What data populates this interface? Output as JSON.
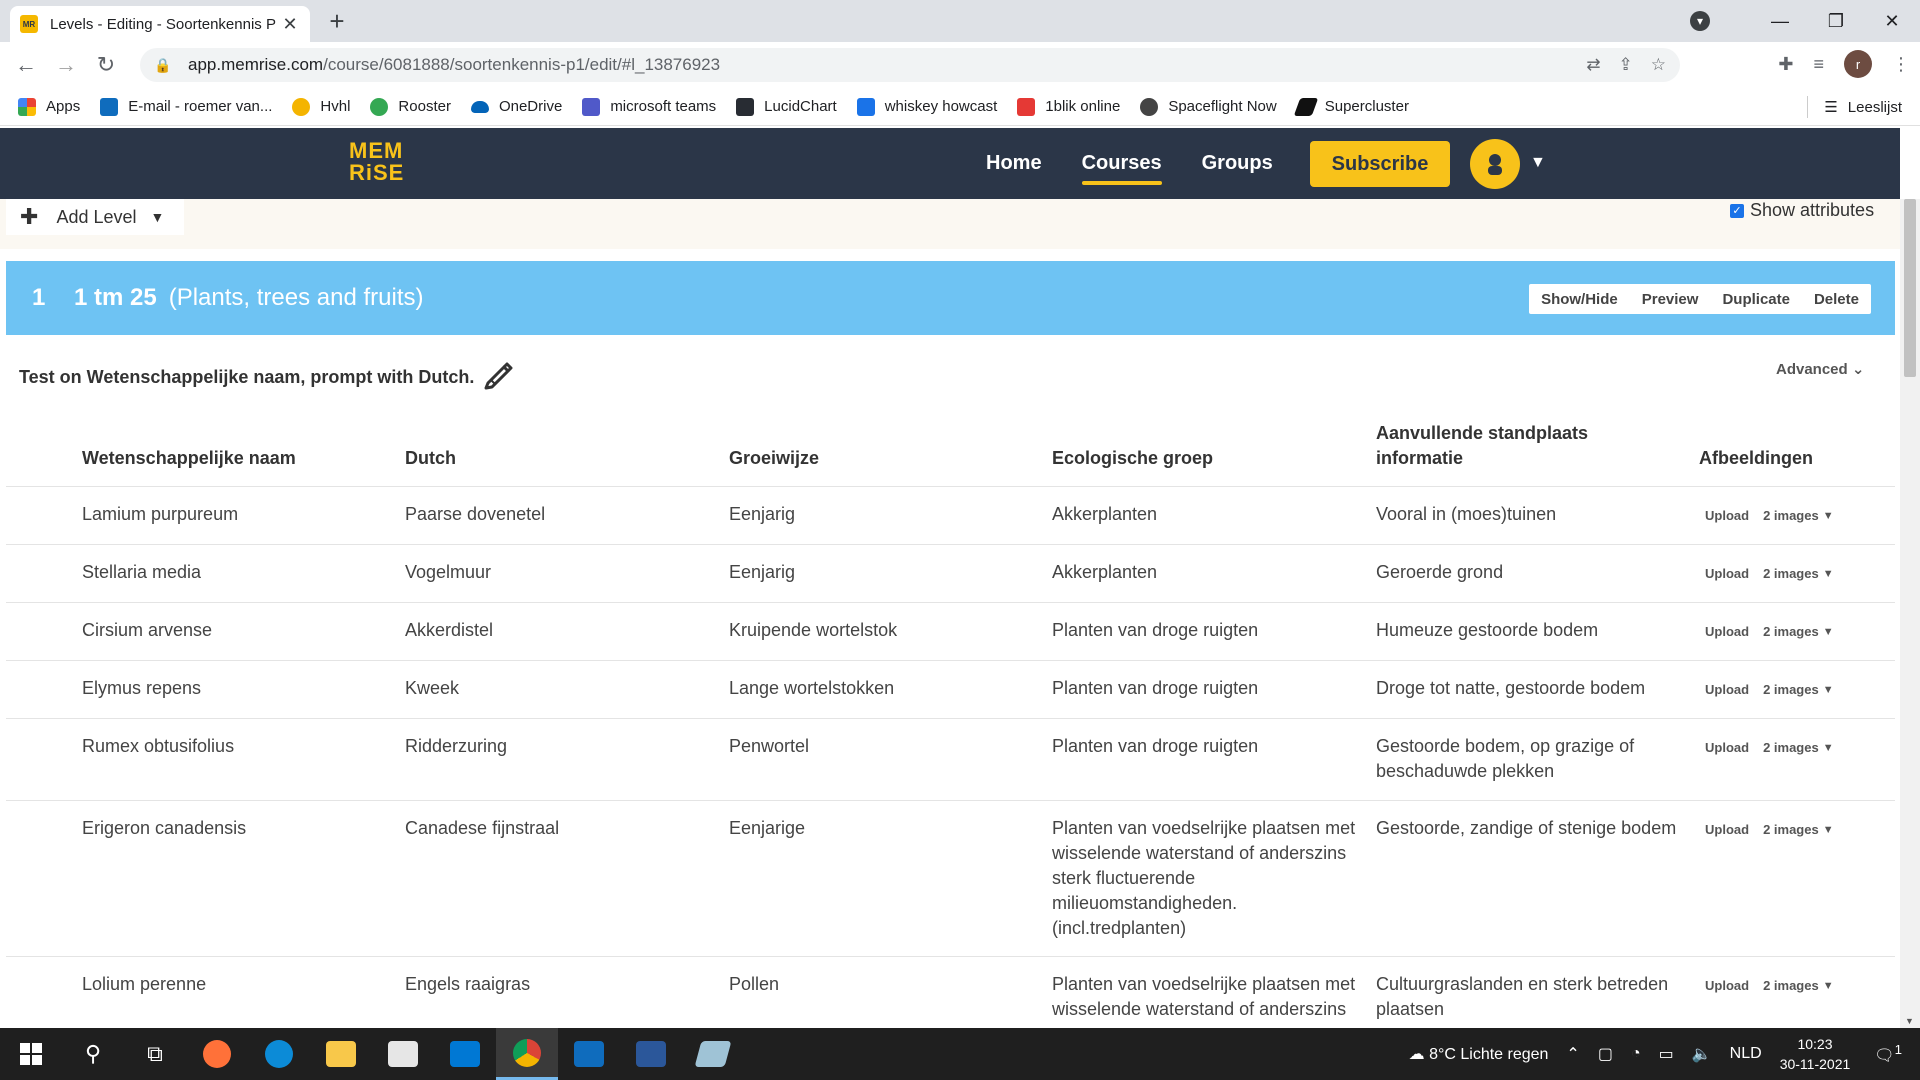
{
  "browser": {
    "tab_title": "Levels - Editing - Soortenkennis P",
    "url_domain": "app.memrise.com",
    "url_path": "/course/6081888/soortenkennis-p1/edit/#l_13876923",
    "profile_initial": "r",
    "bookmarks": [
      {
        "label": "Apps",
        "color": "#ea4335"
      },
      {
        "label": "E-mail - roemer van...",
        "color": "#0f6cbd"
      },
      {
        "label": "Hvhl",
        "color": "#f4b400"
      },
      {
        "label": "Rooster",
        "color": "#34a853"
      },
      {
        "label": "OneDrive",
        "color": "#0364b8"
      },
      {
        "label": "microsoft teams",
        "color": "#5059c9"
      },
      {
        "label": "LucidChart",
        "color": "#282c33"
      },
      {
        "label": "whiskey howcast",
        "color": "#1a73e8"
      },
      {
        "label": "1blik online",
        "color": "#e53935"
      },
      {
        "label": "Spaceflight Now",
        "color": "#444444"
      },
      {
        "label": "Supercluster",
        "color": "#111111"
      }
    ],
    "reading_list": "Leeslijst"
  },
  "header": {
    "logo_line1": "MEM",
    "logo_line2": "RiSE",
    "nav": [
      "Home",
      "Courses",
      "Groups"
    ],
    "subscribe": "Subscribe"
  },
  "toolbar": {
    "add_level": "Add Level",
    "show_attributes": "Show attributes"
  },
  "level": {
    "number": "1",
    "name": "1 tm 25",
    "subtitle": "(Plants, trees and fruits)",
    "actions": [
      "Show/Hide",
      "Preview",
      "Duplicate",
      "Delete"
    ],
    "test_line": "Test on Wetenschappelijke naam, prompt with Dutch.",
    "advanced": "Advanced"
  },
  "table": {
    "headers": {
      "col1": "Wetenschappelijke naam",
      "col2": "Dutch",
      "col3": "Groeiwijze",
      "col4": "Ecologische groep",
      "col5_line1": "Aanvullende standplaats",
      "col5_line2": "informatie",
      "col6": "Afbeeldingen"
    },
    "upload_label": "Upload",
    "rows": [
      {
        "c1": "Lamium purpureum",
        "c2": "Paarse dovenetel",
        "c3": "Eenjarig",
        "c4": [
          "Akkerplanten"
        ],
        "c5": [
          "Vooral in (moes)tuinen"
        ],
        "images": "2 images"
      },
      {
        "c1": "Stellaria media",
        "c2": "Vogelmuur",
        "c3": "Eenjarig",
        "c4": [
          "Akkerplanten"
        ],
        "c5": [
          "Geroerde grond"
        ],
        "images": "2 images"
      },
      {
        "c1": "Cirsium arvense",
        "c2": "Akkerdistel",
        "c3": "Kruipende wortelstok",
        "c4": [
          "Planten van droge ruigten"
        ],
        "c5": [
          "Humeuze gestoorde bodem"
        ],
        "images": "2 images"
      },
      {
        "c1": "Elymus repens",
        "c2": "Kweek",
        "c3": "Lange wortelstokken",
        "c4": [
          "Planten van droge ruigten"
        ],
        "c5": [
          "Droge tot natte, gestoorde bodem"
        ],
        "images": "2 images"
      },
      {
        "c1": "Rumex obtusifolius",
        "c2": "Ridderzuring",
        "c3": "Penwortel",
        "c4": [
          "Planten van droge ruigten"
        ],
        "c5": [
          "Gestoorde bodem, op grazige of",
          "beschaduwde plekken"
        ],
        "images": "2 images"
      },
      {
        "c1": "Erigeron canadensis",
        "c2": "Canadese fijnstraal",
        "c3": "Eenjarige",
        "c4": [
          "Planten van voedselrijke plaatsen met",
          "wisselende waterstand of anderszins",
          "sterk fluctuerende",
          "milieuomstandigheden.",
          "(incl.tredplanten)"
        ],
        "c5": [
          "Gestoorde, zandige of stenige bodem"
        ],
        "images": "2 images"
      },
      {
        "c1": "Lolium perenne",
        "c2": "Engels raaigras",
        "c3": "Pollen",
        "c4": [
          "Planten van voedselrijke plaatsen met",
          "wisselende waterstand of anderszins"
        ],
        "c5": [
          "Cultuurgraslanden en sterk betreden",
          "plaatsen"
        ],
        "images": "2 images"
      }
    ]
  },
  "taskbar": {
    "weather": "8°C  Lichte regen",
    "lang": "NLD",
    "time": "10:23",
    "date": "30-11-2021",
    "notifications": "1"
  }
}
